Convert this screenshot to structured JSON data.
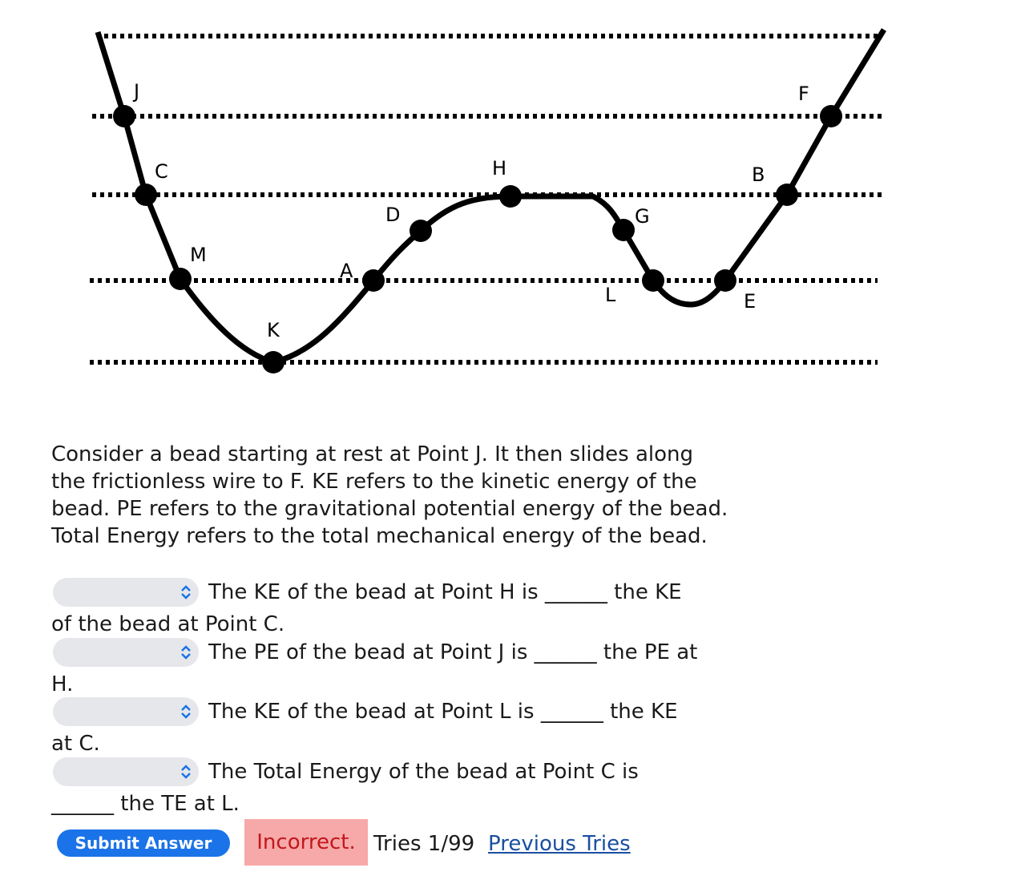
{
  "diagram": {
    "point_labels": {
      "J": "J",
      "C": "C",
      "M": "M",
      "K": "K",
      "A": "A",
      "D": "D",
      "H": "H",
      "L": "L",
      "G": "G",
      "E": "E",
      "B": "B",
      "F": "F"
    }
  },
  "problem_text": "Consider a bead starting at rest at Point J. It then slides along the frictionless wire to F. KE refers to the kinetic energy of the bead. PE refers to the gravitational potential energy of the bead. Total Energy refers to the total mechanical energy of the bead.",
  "questions": [
    {
      "line1": "The KE of the bead at Point H is ______ the KE",
      "line2": "of the bead at Point C.",
      "selected": ""
    },
    {
      "line1": "The PE of the bead at Point J is ______ the PE at",
      "line2": "H.",
      "selected": ""
    },
    {
      "line1": "The KE of the bead at Point L is ______ the KE",
      "line2": "at C.",
      "selected": ""
    },
    {
      "line1": "The Total Energy of the bead at Point C is",
      "line2": "______ the TE at L.",
      "selected": ""
    }
  ],
  "submit_label": "Submit Answer",
  "status": {
    "result": "Incorrect.",
    "tries": "Tries 1/99",
    "previous_tries": "Previous Tries"
  },
  "colors": {
    "submit_bg": "#1a73e8",
    "incorrect_bg": "#f7a9a9",
    "incorrect_text": "#c2181d",
    "link": "#1a4fa0",
    "select_bg": "#e6e7ea",
    "chevron": "#1a73e8"
  }
}
